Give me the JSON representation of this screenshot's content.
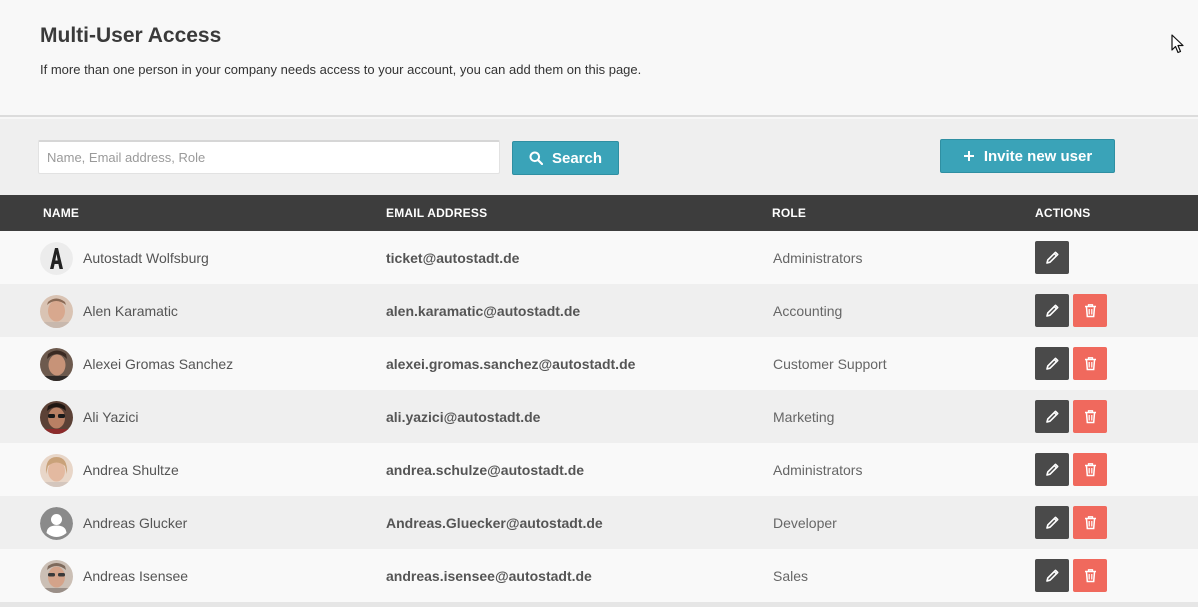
{
  "header": {
    "title": "Multi-User Access",
    "subtitle": "If more than one person in your company needs access to your account, you can add them on this page."
  },
  "toolbar": {
    "search_placeholder": "Name, Email address, Role",
    "search_value": "",
    "search_label": "Search",
    "invite_label": "Invite new user"
  },
  "table": {
    "columns": [
      "NAME",
      "EMAIL ADDRESS",
      "ROLE",
      "ACTIONS"
    ],
    "rows": [
      {
        "name": "Autostadt Wolfsburg",
        "email": "ticket@autostadt.de",
        "role": "Administrators",
        "avatar": "logo-a",
        "deletable": false
      },
      {
        "name": "Alen Karamatic",
        "email": "alen.karamatic@autostadt.de",
        "role": "Accounting",
        "avatar": "photo",
        "deletable": true
      },
      {
        "name": "Alexei Gromas Sanchez",
        "email": "alexei.gromas.sanchez@autostadt.de",
        "role": "Customer Support",
        "avatar": "photo",
        "deletable": true
      },
      {
        "name": "Ali Yazici",
        "email": "ali.yazici@autostadt.de",
        "role": "Marketing",
        "avatar": "photo",
        "deletable": true
      },
      {
        "name": "Andrea Shultze",
        "email": "andrea.schulze@autostadt.de",
        "role": "Administrators",
        "avatar": "photo",
        "deletable": true
      },
      {
        "name": "Andreas Glucker",
        "email": "Andreas.Gluecker@autostadt.de",
        "role": "Developer",
        "avatar": "placeholder",
        "deletable": true
      },
      {
        "name": "Andreas Isensee",
        "email": "andreas.isensee@autostadt.de",
        "role": "Sales",
        "avatar": "photo",
        "deletable": true
      }
    ]
  },
  "colors": {
    "accent": "#3aa3b8",
    "header_dark": "#3d3d3d",
    "edit": "#4a4a4a",
    "delete": "#f0695d"
  },
  "icons": {
    "search": "search-icon",
    "invite": "plus-icon",
    "edit": "pencil-icon",
    "delete": "trash-icon",
    "cursor": "mouse-pointer-icon"
  }
}
